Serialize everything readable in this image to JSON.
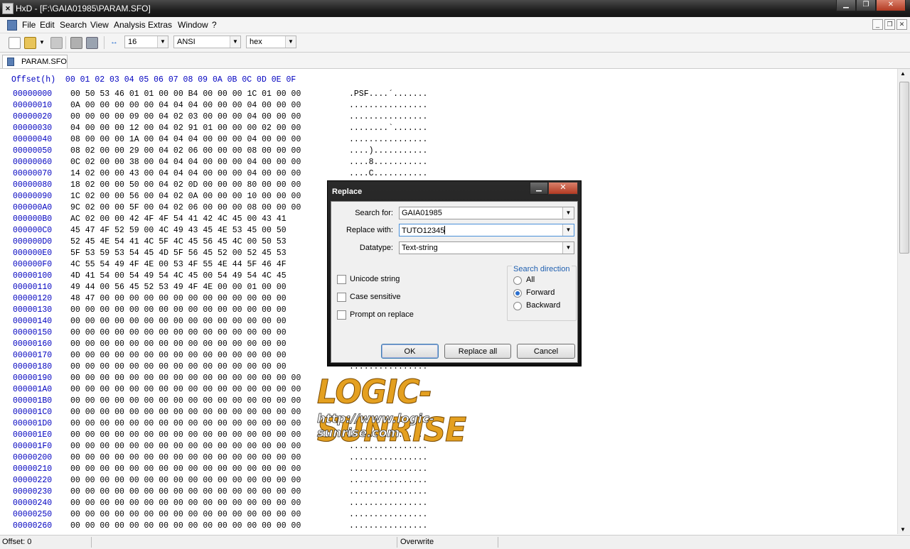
{
  "window": {
    "title": "HxD - [F:\\GAIA01985\\PARAM.SFO]",
    "app_icon_text": "✕"
  },
  "menu": [
    "File",
    "Edit",
    "Search",
    "View",
    "Analysis",
    "Extras",
    "Window",
    "?"
  ],
  "toolbar": {
    "bytes_per_row": "16",
    "charset": "ANSI",
    "offset_base": "hex"
  },
  "tab": {
    "label": "PARAM.SFO"
  },
  "editor": {
    "offset_header": "Offset(h)  00 01 02 03 04 05 06 07 08 09 0A 0B 0C 0D 0E 0F",
    "rows": [
      {
        "off": "00000000",
        "hex": "00 50 53 46 01 01 00 00 B4 00 00 00 1C 01 00 00",
        "asc": ".PSF....´......."
      },
      {
        "off": "00000010",
        "hex": "0A 00 00 00 00 00 04 04 04 00 00 00 04 00 00 00",
        "asc": "................"
      },
      {
        "off": "00000020",
        "hex": "00 00 00 00 09 00 04 02 03 00 00 00 04 00 00 00",
        "asc": "................"
      },
      {
        "off": "00000030",
        "hex": "04 00 00 00 12 00 04 02 91 01 00 00 00 02 00 00",
        "asc": "........`......."
      },
      {
        "off": "00000040",
        "hex": "08 00 00 00 1A 00 04 04 04 00 00 00 04 00 00 00",
        "asc": "................"
      },
      {
        "off": "00000050",
        "hex": "08 02 00 00 29 00 04 02 06 00 00 00 08 00 00 00",
        "asc": "....)..........."
      },
      {
        "off": "00000060",
        "hex": "0C 02 00 00 38 00 04 04 04 00 00 00 04 00 00 00",
        "asc": "....8..........."
      },
      {
        "off": "00000070",
        "hex": "14 02 00 00 43 00 04 04 04 00 00 00 04 00 00 00",
        "asc": "....C..........."
      },
      {
        "off": "00000080",
        "hex": "18 02 00 00 50 00 04 02 0D 00 00 00 80 00 00 00",
        "asc": ""
      },
      {
        "off": "00000090",
        "hex": "1C 02 00 00 56 00 04 02 0A 00 00 00 10 00 00 00",
        "asc": ""
      },
      {
        "off": "000000A0",
        "hex": "9C 02 00 00 5F 00 04 02 06 00 00 00 08 00 00 00",
        "asc": ""
      },
      {
        "off": "000000B0",
        "hex": "AC 02 00 00 42 4F 4F 54 41 42 4C 45 00 43 41",
        "asc": ""
      },
      {
        "off": "000000C0",
        "hex": "45 47 4F 52 59 00 4C 49 43 45 4E 53 45 00 50",
        "asc": ""
      },
      {
        "off": "000000D0",
        "hex": "52 45 4E 54 41 4C 5F 4C 45 56 45 4C 00 50 53",
        "asc": ""
      },
      {
        "off": "000000E0",
        "hex": "5F 53 59 53 54 45 4D 5F 56 45 52 00 52 45 53",
        "asc": ""
      },
      {
        "off": "000000F0",
        "hex": "4C 55 54 49 4F 4E 00 53 4F 55 4E 44 5F 46 4F",
        "asc": ""
      },
      {
        "off": "00000100",
        "hex": "4D 41 54 00 54 49 54 4C 45 00 54 49 54 4C 45",
        "asc": ""
      },
      {
        "off": "00000110",
        "hex": "49 44 00 56 45 52 53 49 4F 4E 00 00 01 00 00",
        "asc": ""
      },
      {
        "off": "00000120",
        "hex": "48 47 00 00 00 00 00 00 00 00 00 00 00 00 00",
        "asc": ""
      },
      {
        "off": "00000130",
        "hex": "00 00 00 00 00 00 00 00 00 00 00 00 00 00 00",
        "asc": ""
      },
      {
        "off": "00000140",
        "hex": "00 00 00 00 00 00 00 00 00 00 00 00 00 00 00",
        "asc": ""
      },
      {
        "off": "00000150",
        "hex": "00 00 00 00 00 00 00 00 00 00 00 00 00 00 00",
        "asc": ""
      },
      {
        "off": "00000160",
        "hex": "00 00 00 00 00 00 00 00 00 00 00 00 00 00 00",
        "asc": ""
      },
      {
        "off": "00000170",
        "hex": "00 00 00 00 00 00 00 00 00 00 00 00 00 00 00",
        "asc": ""
      },
      {
        "off": "00000180",
        "hex": "00 00 00 00 00 00 00 00 00 00 00 00 00 00 00",
        "asc": "................"
      },
      {
        "off": "00000190",
        "hex": "00 00 00 00 00 00 00 00 00 00 00 00 00 00 00 00",
        "asc": ""
      },
      {
        "off": "000001A0",
        "hex": "00 00 00 00 00 00 00 00 00 00 00 00 00 00 00 00",
        "asc": ""
      },
      {
        "off": "000001B0",
        "hex": "00 00 00 00 00 00 00 00 00 00 00 00 00 00 00 00",
        "asc": ""
      },
      {
        "off": "000001C0",
        "hex": "00 00 00 00 00 00 00 00 00 00 00 00 00 00 00 00",
        "asc": ""
      },
      {
        "off": "000001D0",
        "hex": "00 00 00 00 00 00 00 00 00 00 00 00 00 00 00 00",
        "asc": ""
      },
      {
        "off": "000001E0",
        "hex": "00 00 00 00 00 00 00 00 00 00 00 00 00 00 00 00",
        "asc": "................"
      },
      {
        "off": "000001F0",
        "hex": "00 00 00 00 00 00 00 00 00 00 00 00 00 00 00 00",
        "asc": "................"
      },
      {
        "off": "00000200",
        "hex": "00 00 00 00 00 00 00 00 00 00 00 00 00 00 00 00",
        "asc": "................"
      },
      {
        "off": "00000210",
        "hex": "00 00 00 00 00 00 00 00 00 00 00 00 00 00 00 00",
        "asc": "................"
      },
      {
        "off": "00000220",
        "hex": "00 00 00 00 00 00 00 00 00 00 00 00 00 00 00 00",
        "asc": "................"
      },
      {
        "off": "00000230",
        "hex": "00 00 00 00 00 00 00 00 00 00 00 00 00 00 00 00",
        "asc": "................"
      },
      {
        "off": "00000240",
        "hex": "00 00 00 00 00 00 00 00 00 00 00 00 00 00 00 00",
        "asc": "................"
      },
      {
        "off": "00000250",
        "hex": "00 00 00 00 00 00 00 00 00 00 00 00 00 00 00 00",
        "asc": "................"
      },
      {
        "off": "00000260",
        "hex": "00 00 00 00 00 00 00 00 00 00 00 00 00 00 00 00",
        "asc": "................"
      }
    ]
  },
  "status": {
    "offset": "Offset: 0",
    "mode": "Overwrite"
  },
  "dialog": {
    "title": "Replace",
    "search_label": "Search for:",
    "search_value": "GAIA01985",
    "replace_label": "Replace with:",
    "replace_value": "TUTO12345",
    "datatype_label": "Datatype:",
    "datatype_value": "Text-string",
    "unicode_label": "Unicode string",
    "case_label": "Case sensitive",
    "prompt_label": "Prompt on replace",
    "direction_title": "Search direction",
    "dir_all": "All",
    "dir_forward": "Forward",
    "dir_backward": "Backward",
    "selected_direction": "Forward",
    "ok": "OK",
    "replace_all": "Replace all",
    "cancel": "Cancel"
  },
  "watermark": {
    "brand": "LOGIC-SUNRISE",
    "url": "http://www.logic-sunrise.com"
  }
}
